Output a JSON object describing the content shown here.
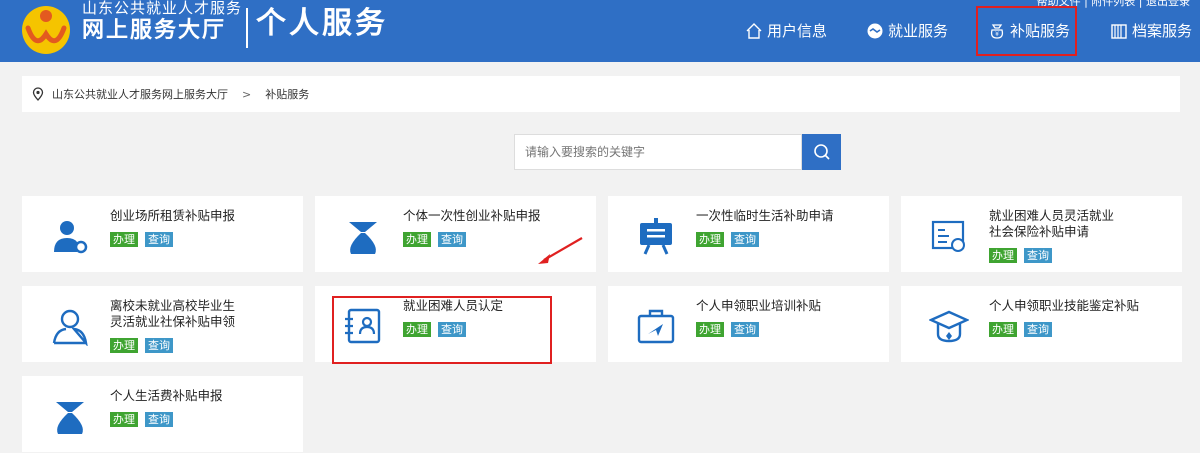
{
  "header": {
    "brand_top": "山东公共就业人才服务",
    "brand_bottom": "网上服务大厅",
    "page_heading": "个人服务",
    "top_links": "帮助文件 | 附件列表 | 退出登录",
    "nav": [
      {
        "label": "用户信息",
        "icon": "home-icon"
      },
      {
        "label": "就业服务",
        "icon": "handshake-icon"
      },
      {
        "label": "补贴服务",
        "icon": "subsidy-icon"
      },
      {
        "label": "档案服务",
        "icon": "archive-icon"
      }
    ]
  },
  "breadcrumb": {
    "home": "山东公共就业人才服务网上服务大厅",
    "separator": ">",
    "current": "补贴服务"
  },
  "search": {
    "placeholder": "请输入要搜索的关键字"
  },
  "buttons": {
    "do": "办理",
    "query": "查询"
  },
  "cards": [
    {
      "title": "创业场所租赁补贴申报",
      "icon": "user-gear-icon"
    },
    {
      "title": "个体一次性创业补贴申报",
      "icon": "money-bag-icon"
    },
    {
      "title": "一次性临时生活补助申请",
      "icon": "easel-icon"
    },
    {
      "title_line1": "就业困难人员灵活就业",
      "title_line2": "社会保险补贴申请",
      "icon": "certificate-icon"
    },
    {
      "title_line1": "离校未就业高校毕业生",
      "title_line2": "灵活就业社保补贴申领",
      "icon": "person-outline-icon"
    },
    {
      "title": "就业困难人员认定",
      "icon": "id-card-icon"
    },
    {
      "title": "个人申领职业培训补贴",
      "icon": "briefcase-icon"
    },
    {
      "title": "个人申领职业技能鉴定补贴",
      "icon": "graduation-cap-icon"
    },
    {
      "title": "个人生活费补贴申报",
      "icon": "money-bag-icon"
    }
  ],
  "colors": {
    "header_bg": "#2f6fc5",
    "icon_blue": "#1e6cc0",
    "btn_do": "#3fa431",
    "btn_query": "#3e97c8",
    "highlight": "#e02020"
  }
}
